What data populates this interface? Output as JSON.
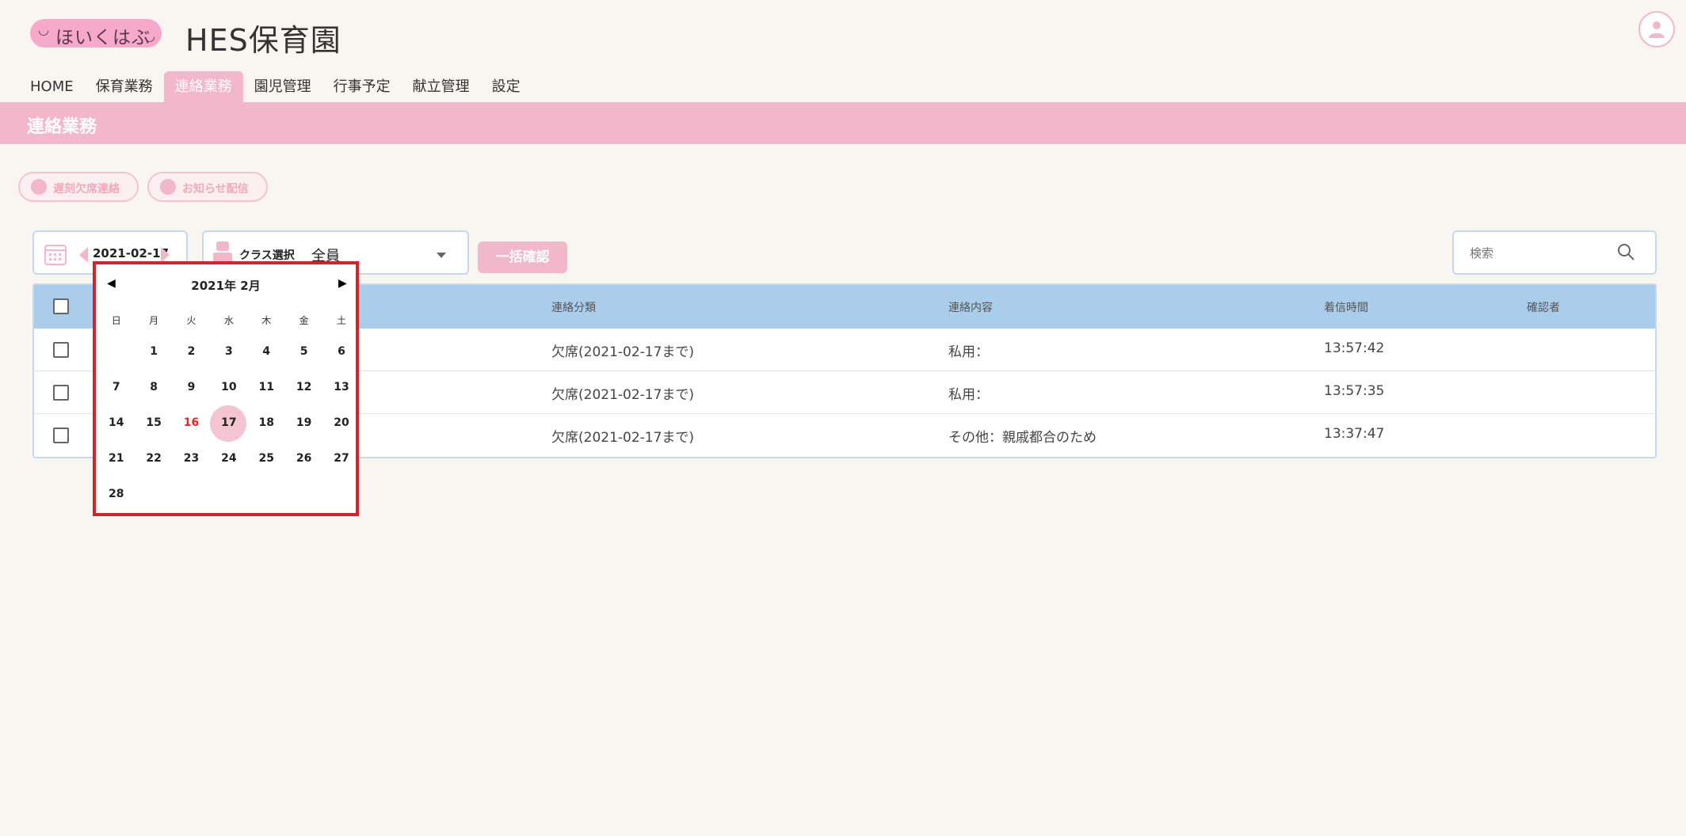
{
  "header": {
    "logo_text": "ほいくはぶ",
    "app_title": "HES保育園"
  },
  "nav": [
    {
      "label": "HOME",
      "active": false
    },
    {
      "label": "保育業務",
      "active": false
    },
    {
      "label": "連絡業務",
      "active": true
    },
    {
      "label": "園児管理",
      "active": false
    },
    {
      "label": "行事予定",
      "active": false
    },
    {
      "label": "献立管理",
      "active": false
    },
    {
      "label": "設定",
      "active": false
    }
  ],
  "banner": {
    "title": "連絡業務"
  },
  "actions": {
    "absence_label": "遅刻欠席連絡",
    "notice_label": "お知らせ配信"
  },
  "filters": {
    "date": "2021-02-17",
    "class_label": "クラス選択",
    "class_value": "全員",
    "bulk_confirm_label": "一括確認",
    "search_placeholder": "検索"
  },
  "table": {
    "headers": {
      "category": "連絡分類",
      "content": "連絡内容",
      "time": "着信時間",
      "confirmer": "確認者"
    },
    "rows": [
      {
        "category": "欠席(2021-02-17まで)",
        "content": "私用：",
        "time": "13:57:42",
        "confirmer": ""
      },
      {
        "category": "欠席(2021-02-17まで)",
        "content": "私用：",
        "time": "13:57:35",
        "confirmer": ""
      },
      {
        "category": "欠席(2021-02-17まで)",
        "content": "その他：親戚都合のため",
        "time": "13:37:47",
        "confirmer": ""
      }
    ]
  },
  "calendar": {
    "title": "2021年 2月",
    "prev": "◀",
    "next": "▶",
    "weekdays": [
      "日",
      "月",
      "火",
      "水",
      "木",
      "金",
      "土"
    ],
    "leading_blanks": 1,
    "days": [
      "1",
      "2",
      "3",
      "4",
      "5",
      "6",
      "7",
      "8",
      "9",
      "10",
      "11",
      "12",
      "13",
      "14",
      "15",
      "16",
      "17",
      "18",
      "19",
      "20",
      "21",
      "22",
      "23",
      "24",
      "25",
      "26",
      "27",
      "28"
    ],
    "selected_day": "17",
    "red_day": "16"
  },
  "colors": {
    "accent_pink": "#f3b7cc",
    "table_header_blue": "#a9cdea",
    "highlight_red": "#d7222a"
  }
}
